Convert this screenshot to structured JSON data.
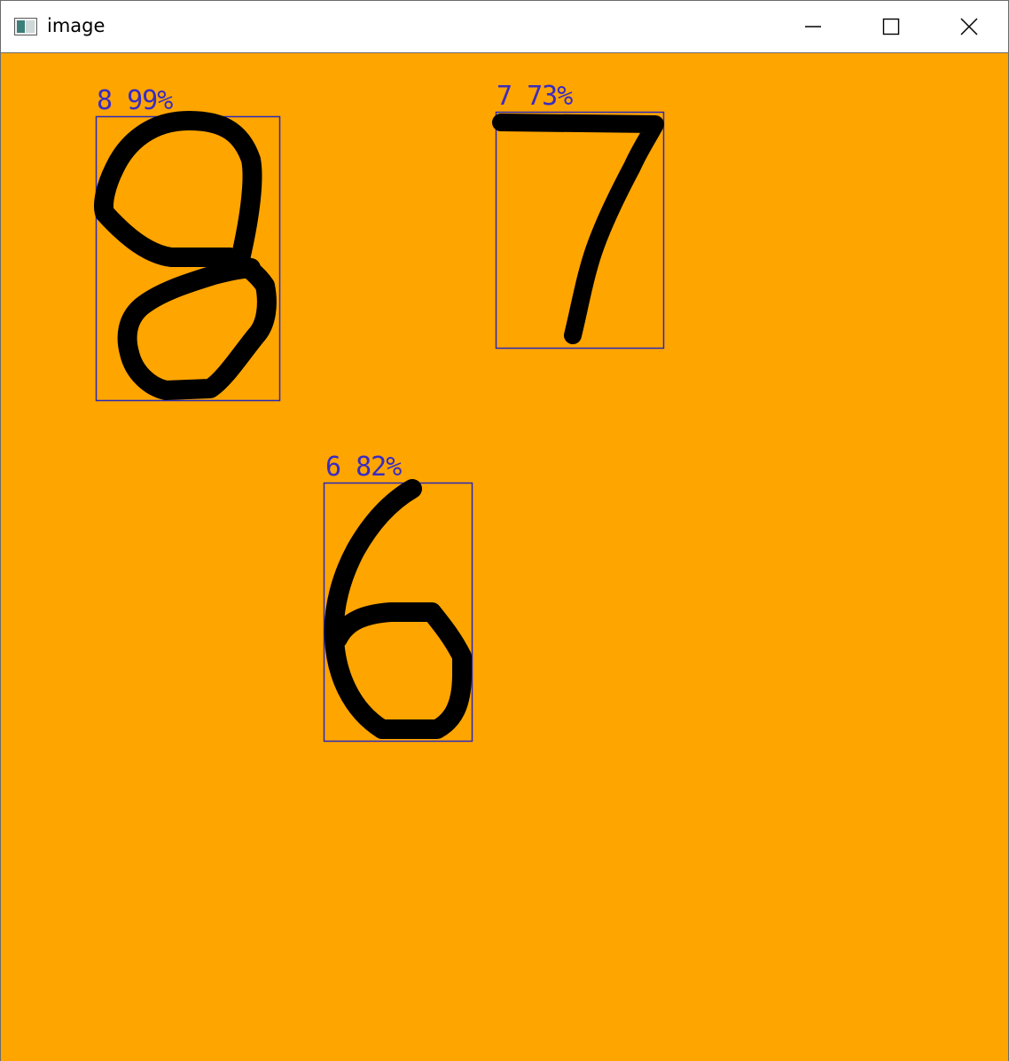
{
  "window": {
    "title": "image",
    "icon": "opencv-window-icon",
    "controls": {
      "minimize_icon": "minimize-icon",
      "maximize_icon": "maximize-icon",
      "close_icon": "close-icon"
    }
  },
  "canvas": {
    "background_color": "#FFA500",
    "stroke_color": "#000000",
    "box_color": "#2a2ab8"
  },
  "detections": [
    {
      "label": "8 99%"
    },
    {
      "label": "7 73%"
    },
    {
      "label": "6 82%"
    }
  ]
}
